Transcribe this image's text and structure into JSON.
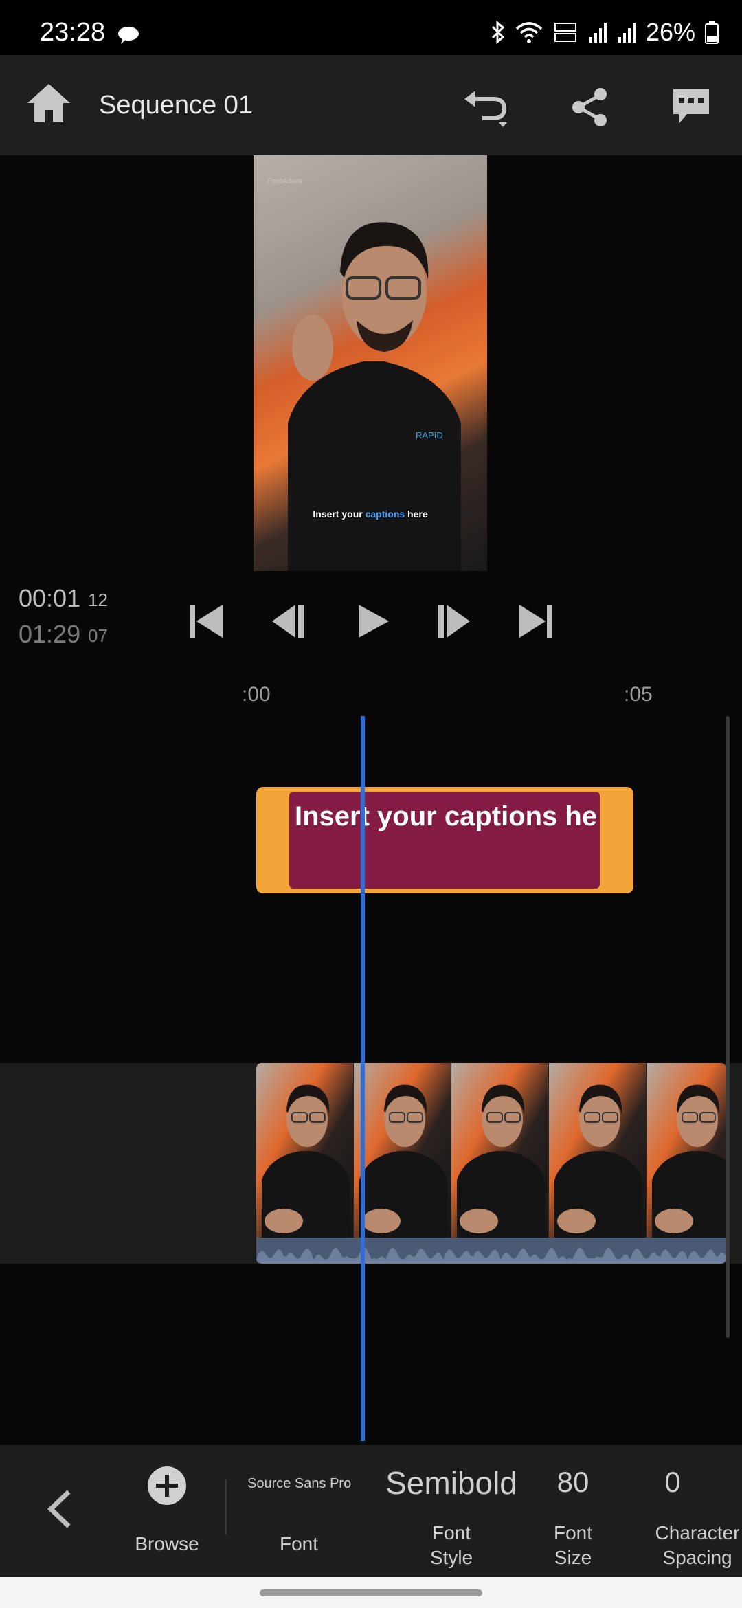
{
  "status_bar": {
    "time": "23:28",
    "battery": "26%",
    "icons": [
      "chat-bubble-icon",
      "bluetooth-icon",
      "wifi-icon",
      "volte-icon",
      "signal-icon",
      "signal-icon",
      "battery-icon"
    ]
  },
  "app_bar": {
    "title": "Sequence 01",
    "icons": [
      "home-icon",
      "undo-icon",
      "share-icon",
      "captions-icon"
    ]
  },
  "preview": {
    "watermark": "PostAdora",
    "caption_prefix": "Insert your ",
    "caption_highlight": "captions",
    "caption_suffix": " here",
    "highlight_color": "#4aa3ff"
  },
  "timecode": {
    "current": "00:01",
    "current_frames": "12",
    "total": "01:29",
    "total_frames": "07"
  },
  "transport": {
    "icons": [
      "skip-to-start-icon",
      "step-back-icon",
      "play-icon",
      "step-forward-icon",
      "skip-to-end-icon"
    ]
  },
  "ruler": {
    "start": ":00",
    "mark": ":05"
  },
  "caption_clip": {
    "text": "Insert your captions he",
    "outer_color": "#f4a53a",
    "inner_color": "#841c46"
  },
  "playhead_color": "#2f6fdc",
  "bottom_panel": {
    "browse_label": "Browse",
    "font_value": "Source Sans Pro",
    "font_label": "Font",
    "style_value": "Semibold",
    "style_label_1": "Font",
    "style_label_2": "Style",
    "size_value": "80",
    "size_label_1": "Font",
    "size_label_2": "Size",
    "spacing_value": "0",
    "spacing_label_1": "Character",
    "spacing_label_2": "Spacing"
  }
}
